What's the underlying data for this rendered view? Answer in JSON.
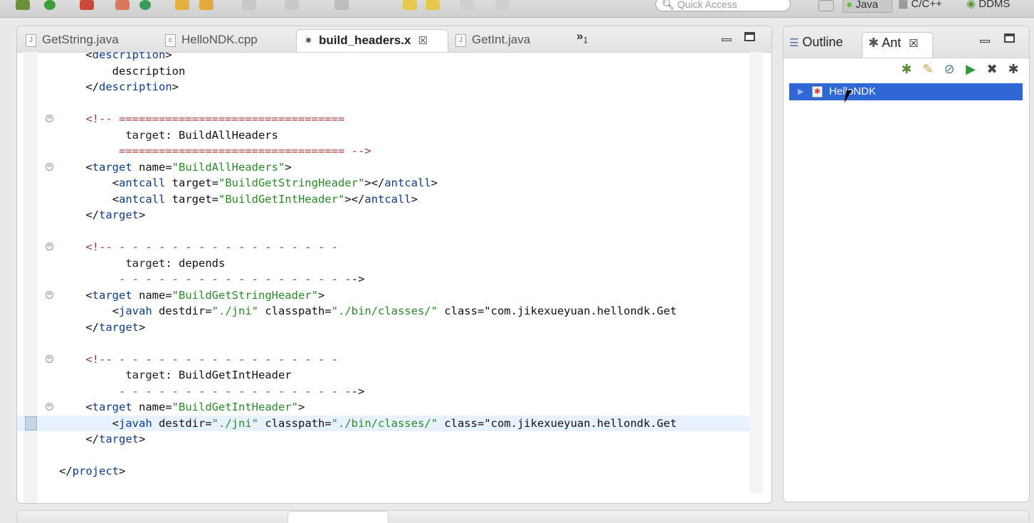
{
  "toolbar": {
    "quick_access_placeholder": "Quick Access",
    "perspectives": [
      {
        "label": "Java",
        "active": true
      },
      {
        "label": "C/C++",
        "active": false
      },
      {
        "label": "DDMS",
        "active": false
      }
    ]
  },
  "editor": {
    "tabs": [
      {
        "label": "GetString.java",
        "icon": "java-file-icon",
        "active": false
      },
      {
        "label": "HelloNDK.cpp",
        "icon": "cpp-file-icon",
        "active": false
      },
      {
        "label": "build_headers.x",
        "icon": "ant-file-icon",
        "active": true
      },
      {
        "label": "GetInt.java",
        "icon": "java-file-icon",
        "active": false
      }
    ],
    "overflow_label": "»",
    "overflow_count": "1",
    "lines": [
      {
        "text": "    <description>"
      },
      {
        "text": "        description"
      },
      {
        "text": "    </description>"
      },
      {
        "text": ""
      },
      {
        "text": "    <!-- ==================================",
        "fold": true
      },
      {
        "text": "          target: BuildAllHeaders"
      },
      {
        "text": "         ================================== -->"
      },
      {
        "text": "    <target name=\"BuildAllHeaders\">",
        "fold": true
      },
      {
        "text": "        <antcall target=\"BuildGetStringHeader\"></antcall>"
      },
      {
        "text": "        <antcall target=\"BuildGetIntHeader\"></antcall>"
      },
      {
        "text": "    </target>"
      },
      {
        "text": ""
      },
      {
        "text": "    <!-- - - - - - - - - - - - - - - - - -",
        "fold": true
      },
      {
        "text": "          target: depends"
      },
      {
        "text": "         - - - - - - - - - - - - - - - - - -->"
      },
      {
        "text": "    <target name=\"BuildGetStringHeader\">",
        "fold": true
      },
      {
        "text": "        <javah destdir=\"./jni\" classpath=\"./bin/classes/\" class=\"com.jikexueyuan.hellondk.Get"
      },
      {
        "text": "    </target>"
      },
      {
        "text": ""
      },
      {
        "text": "    <!-- - - - - - - - - - - - - - - - - -",
        "fold": true
      },
      {
        "text": "          target: BuildGetIntHeader"
      },
      {
        "text": "         - - - - - - - - - - - - - - - - - -->"
      },
      {
        "text": "    <target name=\"BuildGetIntHeader\">",
        "fold": true
      },
      {
        "text": "        <javah destdir=\"./jni\" classpath=\"./bin/classes/\" class=\"com.jikexueyuan.hellondk.Get",
        "current": true
      },
      {
        "text": "    </target>"
      },
      {
        "text": ""
      },
      {
        "text": "</project>"
      }
    ]
  },
  "side_panel": {
    "tabs": [
      {
        "label": "Outline",
        "active": false
      },
      {
        "label": "Ant",
        "active": true
      }
    ],
    "tree_items": [
      {
        "label": "HelloNDK",
        "selected": true
      }
    ]
  }
}
